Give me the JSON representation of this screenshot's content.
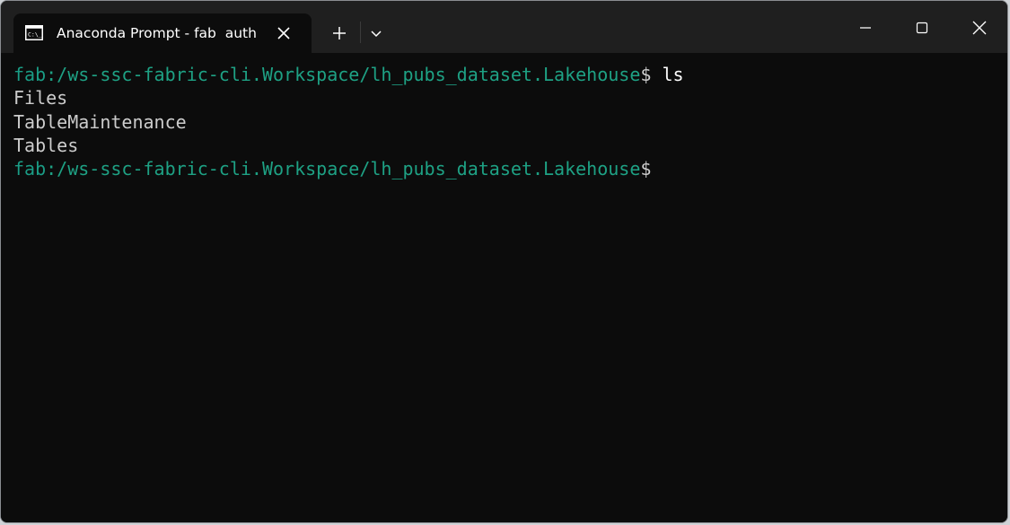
{
  "tab": {
    "title": "Anaconda Prompt - fab  auth",
    "icon": "terminal-icon"
  },
  "titlebar": {
    "new_tab_icon": "plus-icon",
    "dropdown_icon": "chevron-down-icon",
    "minimize_icon": "minimize-icon",
    "maximize_icon": "maximize-icon",
    "close_icon": "close-icon"
  },
  "terminal": {
    "lines": [
      {
        "prompt_user": "fab",
        "prompt_path": ":/ws-ssc-fabric-cli.Workspace/lh_pubs_dataset.Lakehouse",
        "prompt_symbol": "$",
        "command": " ls"
      },
      {
        "output": "Files"
      },
      {
        "output": "TableMaintenance"
      },
      {
        "output": "Tables"
      },
      {
        "prompt_user": "fab",
        "prompt_path": ":/ws-ssc-fabric-cli.Workspace/lh_pubs_dataset.Lakehouse",
        "prompt_symbol": "$",
        "command": ""
      }
    ]
  },
  "colors": {
    "background": "#0c0c0c",
    "titlebar": "#1f1f1f",
    "prompt": "#1ea184",
    "text": "#cccccc"
  }
}
